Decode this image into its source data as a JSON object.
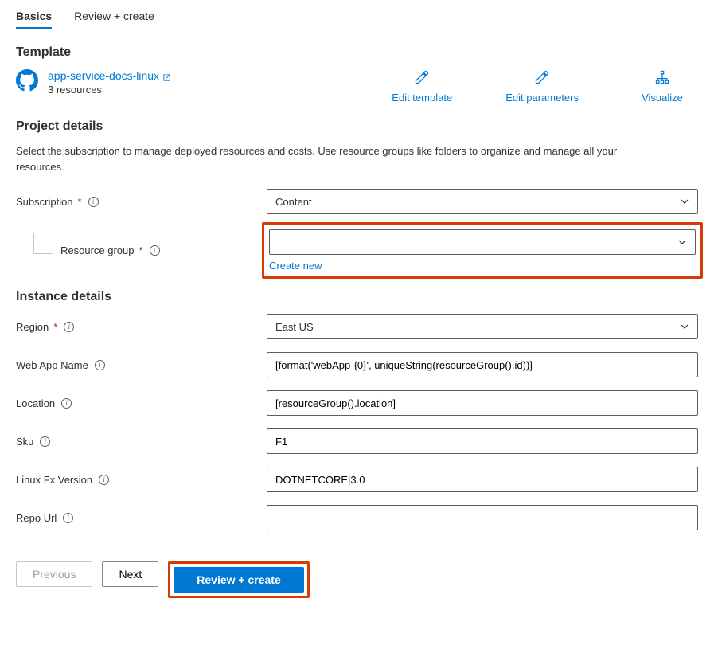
{
  "tabs": {
    "basics": "Basics",
    "review": "Review + create"
  },
  "template": {
    "heading": "Template",
    "link_text": "app-service-docs-linux",
    "resources": "3 resources"
  },
  "actions": {
    "edit_template": "Edit template",
    "edit_parameters": "Edit parameters",
    "visualize": "Visualize"
  },
  "project_details": {
    "heading": "Project details",
    "description": "Select the subscription to manage deployed resources and costs. Use resource groups like folders to organize and manage all your resources.",
    "subscription_label": "Subscription",
    "subscription_value": "Content",
    "resource_group_label": "Resource group",
    "resource_group_value": "",
    "create_new": "Create new"
  },
  "instance_details": {
    "heading": "Instance details",
    "region_label": "Region",
    "region_value": "East US",
    "webapp_label": "Web App Name",
    "webapp_value": "[format('webApp-{0}', uniqueString(resourceGroup().id))]",
    "location_label": "Location",
    "location_value": "[resourceGroup().location]",
    "sku_label": "Sku",
    "sku_value": "F1",
    "linuxfx_label": "Linux Fx Version",
    "linuxfx_value": "DOTNETCORE|3.0",
    "repourl_label": "Repo Url",
    "repourl_value": ""
  },
  "footer": {
    "previous": "Previous",
    "next": "Next",
    "review_create": "Review + create"
  }
}
